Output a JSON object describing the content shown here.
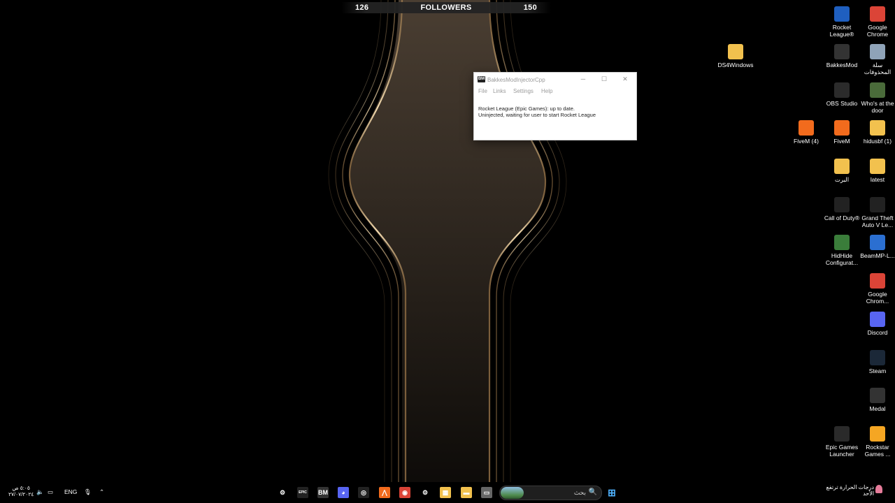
{
  "overlay": {
    "left_count": "126",
    "title": "FOLLOWERS",
    "right_count": "150"
  },
  "desktop_icons": [
    {
      "label": "Rocket League®",
      "icon": "rocket-league-icon",
      "color": "#1f5fbf"
    },
    {
      "label": "Google Chrome",
      "icon": "chrome-icon",
      "color": "#db4437"
    },
    {
      "label": "DS4Windows",
      "icon": "folder-icon",
      "color": "#f2c14e"
    },
    {
      "label": "BakkesMod",
      "icon": "bakkesmod-icon",
      "color": "#333333"
    },
    {
      "label": "سلة المحذوفات",
      "icon": "recycle-bin-icon",
      "color": "#8fa3b8"
    },
    {
      "label": "OBS Studio",
      "icon": "obs-icon",
      "color": "#2b2b2b"
    },
    {
      "label": "Who's at the door",
      "icon": "game-icon",
      "color": "#4a6b3a"
    },
    {
      "label": "FiveM (4)",
      "icon": "fivem-icon",
      "color": "#f26b1d"
    },
    {
      "label": "FiveM",
      "icon": "fivem-icon",
      "color": "#f26b1d"
    },
    {
      "label": "hidusbf (1)",
      "icon": "folder-icon",
      "color": "#f2c14e"
    },
    {
      "label": "البرت",
      "icon": "folder-icon",
      "color": "#f2c14e"
    },
    {
      "label": "latest",
      "icon": "folder-icon",
      "color": "#f2c14e"
    },
    {
      "label": "Call of Duty®",
      "icon": "call-of-duty-icon",
      "color": "#222222"
    },
    {
      "label": "Grand Theft Auto V Le...",
      "icon": "gta-icon",
      "color": "#222222"
    },
    {
      "label": "HidHide Configurat...",
      "icon": "hidhide-icon",
      "color": "#3a7d3a"
    },
    {
      "label": "BeamMP-L...",
      "icon": "beammp-icon",
      "color": "#2b6fd1"
    },
    {
      "label": "Google Chrom...",
      "icon": "chrome-icon",
      "color": "#db4437"
    },
    {
      "label": "Discord",
      "icon": "discord-icon",
      "color": "#5865f2"
    },
    {
      "label": "Steam",
      "icon": "steam-icon",
      "color": "#1b2838"
    },
    {
      "label": "Medal",
      "icon": "medal-icon",
      "color": "#333333"
    },
    {
      "label": "Epic Games Launcher",
      "icon": "epic-games-icon",
      "color": "#2a2a2a"
    },
    {
      "label": "Rockstar Games ...",
      "icon": "rockstar-icon",
      "color": "#f5a623"
    }
  ],
  "window": {
    "logo_text": "BM",
    "title": "BakkesModInjectorCpp",
    "minimize": "─",
    "maximize": "☐",
    "close": "✕",
    "menu": [
      "File",
      "Links",
      "Settings",
      "Help"
    ],
    "status_line1": "Rocket League (Epic Games): up to date.",
    "status_line2": "Uninjected, waiting for user to start Rocket League"
  },
  "taskbar": {
    "apps": [
      {
        "name": "steelseries-icon",
        "glyph": "⚙",
        "color": "#000000"
      },
      {
        "name": "epic-games-icon",
        "glyph": "EPIC",
        "color": "#222222"
      },
      {
        "name": "bakkesmod-icon",
        "glyph": "BM",
        "color": "#333333"
      },
      {
        "name": "discord-icon",
        "glyph": "◕",
        "color": "#5865f2"
      },
      {
        "name": "obs-icon",
        "glyph": "◎",
        "color": "#222222"
      },
      {
        "name": "fivem-icon",
        "glyph": "⋀",
        "color": "#f26b1d"
      },
      {
        "name": "chrome-icon",
        "glyph": "◉",
        "color": "#db4437"
      },
      {
        "name": "steelseries-gg-icon",
        "glyph": "⚙",
        "color": "#000000"
      },
      {
        "name": "store-icon",
        "glyph": "▦",
        "color": "#f2c14e"
      },
      {
        "name": "file-explorer-icon",
        "glyph": "▬",
        "color": "#f2c14e"
      },
      {
        "name": "window-icon",
        "glyph": "▭",
        "color": "#666666"
      }
    ],
    "search_placeholder": "بحث",
    "search_glyph": "🔍",
    "start_glyph": "⊞",
    "weather_line1": "درجات الحرارة ترتفع",
    "weather_line2": "الأحد",
    "language": "ENG",
    "time": "٥:٠٥ ص",
    "date": "٢٧/٠٧/٢٠٢٤"
  }
}
